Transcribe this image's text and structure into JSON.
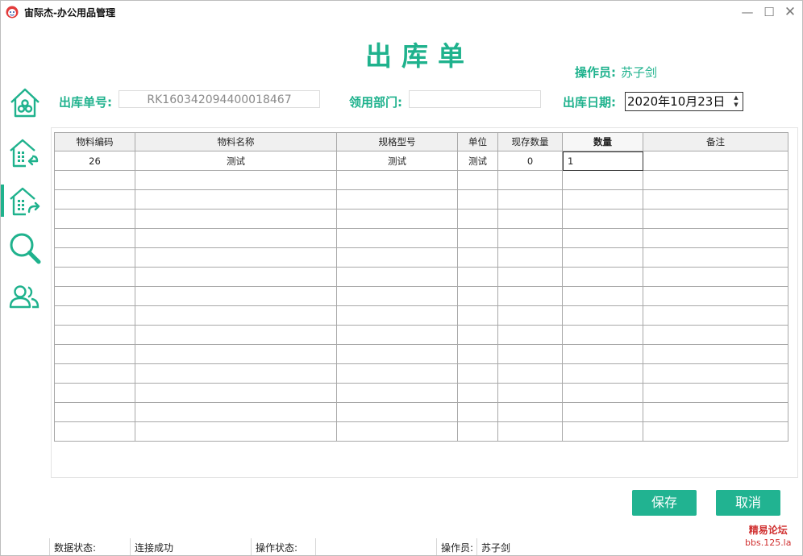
{
  "window": {
    "title": "宙际杰-办公用品管理",
    "controls": {
      "minimize": "—",
      "maximize": "☐",
      "close": "✕"
    }
  },
  "page": {
    "title": "出库单",
    "operator_label": "操作员:",
    "operator_value": "苏子剑"
  },
  "sidebar": {
    "active_index": 2,
    "items": [
      {
        "icon": "home-icon"
      },
      {
        "icon": "inbound-warehouse-icon"
      },
      {
        "icon": "outbound-warehouse-icon"
      },
      {
        "icon": "search-icon"
      },
      {
        "icon": "users-icon"
      }
    ]
  },
  "form": {
    "order_no_label": "出库单号:",
    "order_no_value": "RK160342094400018467",
    "dept_label": "领用部门:",
    "dept_value": "",
    "date_label": "出库日期:",
    "date_value": "2020年10月23日"
  },
  "grid": {
    "columns": [
      "物料编码",
      "物料名称",
      "规格型号",
      "单位",
      "现存数量",
      "数量",
      "备注"
    ],
    "rows": [
      [
        "26",
        "测试",
        "测试",
        "测试",
        "0",
        "1",
        ""
      ]
    ]
  },
  "buttons": {
    "save": "保存",
    "cancel": "取消"
  },
  "status": {
    "data_status_label": "数据状态:",
    "data_status_value": "连接成功",
    "op_status_label": "操作状态:",
    "op_status_value": "",
    "operator_label": "操作员:",
    "operator_value": "苏子剑"
  },
  "watermark": {
    "line1": "精易论坛",
    "line2": "bbs.125.la"
  },
  "colors": {
    "accent": "#1fb28d",
    "button": "#21b391",
    "watermark": "#d03030"
  }
}
